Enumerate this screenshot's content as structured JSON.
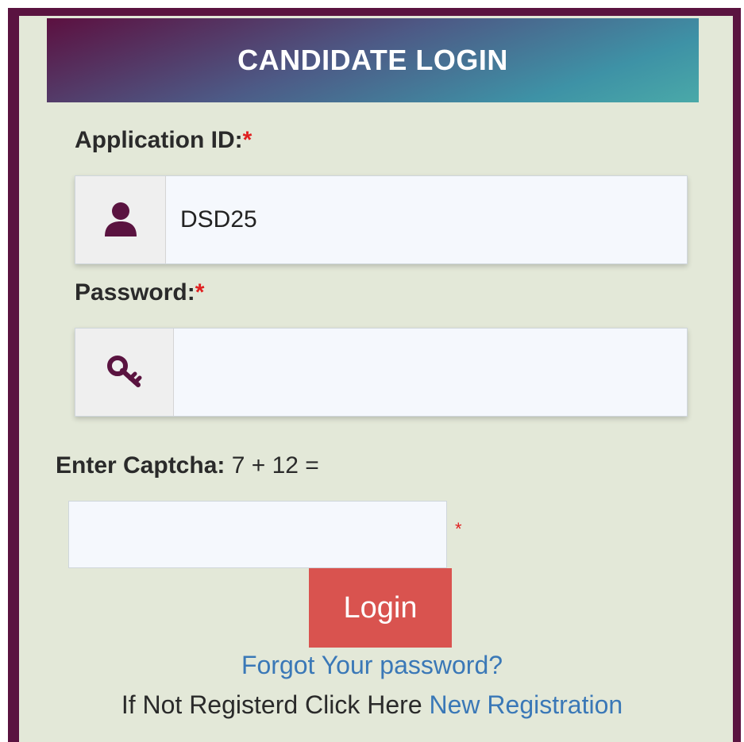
{
  "header": {
    "title": "CANDIDATE LOGIN"
  },
  "application_id": {
    "label": "Application ID:",
    "required_mark": "*",
    "value": "DSD25",
    "icon": "user-icon"
  },
  "password": {
    "label": "Password:",
    "required_mark": "*",
    "value": "",
    "icon": "key-icon"
  },
  "captcha": {
    "label": "Enter Captcha:",
    "question": " 7 + 12 =",
    "value": "",
    "required_mark": "*"
  },
  "actions": {
    "login_label": "Login",
    "forgot_label": "Forgot Your password?",
    "register_prefix": "If Not Registerd Click Here ",
    "register_link": "New Registration"
  },
  "colors": {
    "frame": "#5a1340",
    "panel_bg": "#e3e8d8",
    "icon": "#5a1340",
    "login_button": "#d9534f",
    "link": "#3a78b7",
    "required": "#e02020"
  }
}
